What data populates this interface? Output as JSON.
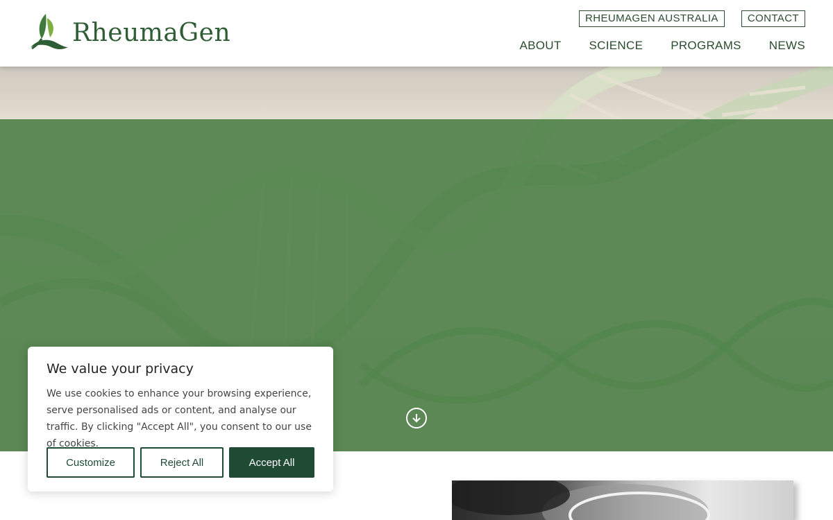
{
  "header": {
    "logo_text": "RheumaGen",
    "top_links": [
      "RHEUMAGEN AUSTRALIA",
      "CONTACT"
    ],
    "nav": [
      "ABOUT",
      "SCIENCE",
      "PROGRAMS",
      "NEWS"
    ]
  },
  "cookie": {
    "title": "We value your privacy",
    "text": "We use cookies to enhance your browsing experience, serve personalised ads or content, and analyse our traffic. By clicking \"Accept All\", you consent to our use of cookies.",
    "customize_label": "Customize",
    "reject_label": "Reject All",
    "accept_label": "Accept All"
  },
  "icons": {
    "logo": "leaf-logo-icon",
    "scroll": "arrow-down-circle-icon"
  },
  "colors": {
    "brand_green": "#2f5d36",
    "overlay_green": "#3e763a",
    "button_dark": "#1f4a34"
  }
}
